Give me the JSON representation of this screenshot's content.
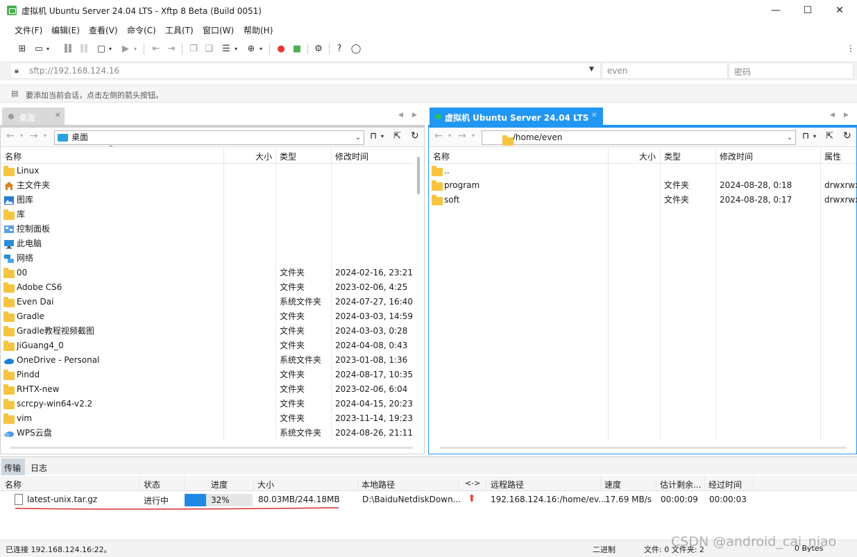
{
  "window": {
    "title": "虚拟机 Ubuntu Server 24.04 LTS - Xftp 8 Beta (Build 0051)",
    "minimize": "—",
    "maximize": "☐",
    "close": "✕"
  },
  "menu": [
    "文件(F)",
    "编辑(E)",
    "查看(V)",
    "命令(C)",
    "工具(T)",
    "窗口(W)",
    "帮助(H)"
  ],
  "address": {
    "url_placeholder": "sftp://192.168.124.16",
    "user_placeholder": "even",
    "password_placeholder": "密码"
  },
  "hint": "要添加当前会话，点击左侧的箭头按钮。",
  "left": {
    "tab": "桌面",
    "path": "桌面",
    "columns": [
      "名称",
      "大小",
      "类型",
      "修改时间"
    ],
    "rows": [
      {
        "name": "Linux",
        "icon": "folder",
        "type": "",
        "date": ""
      },
      {
        "name": "主文件夹",
        "icon": "home",
        "type": "",
        "date": ""
      },
      {
        "name": "图库",
        "icon": "gallery",
        "type": "",
        "date": ""
      },
      {
        "name": "库",
        "icon": "folder",
        "type": "",
        "date": ""
      },
      {
        "name": "控制面板",
        "icon": "control",
        "type": "",
        "date": ""
      },
      {
        "name": "此电脑",
        "icon": "pc",
        "type": "",
        "date": ""
      },
      {
        "name": "网络",
        "icon": "network",
        "type": "",
        "date": ""
      },
      {
        "name": "00",
        "icon": "folder",
        "type": "文件夹",
        "date": "2024-02-16, 23:21"
      },
      {
        "name": "Adobe CS6",
        "icon": "folder",
        "type": "文件夹",
        "date": "2023-02-06, 4:25"
      },
      {
        "name": "Even Dai",
        "icon": "folder",
        "type": "系统文件夹",
        "date": "2024-07-27, 16:40"
      },
      {
        "name": "Gradle",
        "icon": "folder",
        "type": "文件夹",
        "date": "2024-03-03, 14:59"
      },
      {
        "name": "Gradle教程视频截图",
        "icon": "folder",
        "type": "文件夹",
        "date": "2024-03-03, 0:28"
      },
      {
        "name": "JiGuang4_0",
        "icon": "folder",
        "type": "文件夹",
        "date": "2024-04-08, 0:43"
      },
      {
        "name": "OneDrive - Personal",
        "icon": "cloud",
        "type": "系统文件夹",
        "date": "2023-01-08, 1:36"
      },
      {
        "name": "Pindd",
        "icon": "folder",
        "type": "文件夹",
        "date": "2024-08-17, 10:35"
      },
      {
        "name": "RHTX-new",
        "icon": "folder",
        "type": "文件夹",
        "date": "2023-02-06, 6:04"
      },
      {
        "name": "scrcpy-win64-v2.2",
        "icon": "folder",
        "type": "文件夹",
        "date": "2024-04-15, 20:23"
      },
      {
        "name": "vim",
        "icon": "folder",
        "type": "文件夹",
        "date": "2023-11-14, 19:23"
      },
      {
        "name": "WPS云盘",
        "icon": "wpscloud",
        "type": "系统文件夹",
        "date": "2024-08-26, 21:11"
      }
    ]
  },
  "right": {
    "tab": "虚拟机 Ubuntu Server 24.04 LTS",
    "path": "/home/even",
    "columns": [
      "名称",
      "大小",
      "类型",
      "修改时间",
      "属性"
    ],
    "rows": [
      {
        "name": "..",
        "type": "",
        "date": "",
        "attr": ""
      },
      {
        "name": "program",
        "type": "文件夹",
        "date": "2024-08-28, 0:18",
        "attr": "drwxrwx"
      },
      {
        "name": "soft",
        "type": "文件夹",
        "date": "2024-08-28, 0:17",
        "attr": "drwxrwx"
      }
    ]
  },
  "bottom_tabs": [
    "传输",
    "日志"
  ],
  "transfer": {
    "columns": [
      "名称",
      "状态",
      "进度",
      "大小",
      "本地路径",
      "<->",
      "远程路径",
      "速度",
      "估计剩余...",
      "经过时间"
    ],
    "rows": [
      {
        "name": "latest-unix.tar.gz",
        "status": "进行中",
        "progress_label": "32%",
        "progress": 0.32,
        "size": "80.03MB/244.18MB",
        "local": "D:\\BaiduNetdiskDown...",
        "remote": "192.168.124.16:/home/ev...",
        "speed": "17.69 MB/s",
        "remaining": "00:00:09",
        "elapsed": "00:00:03"
      }
    ]
  },
  "status": {
    "connection": "已连接 192.168.124.16:22。",
    "mode": "二进制",
    "files": "文件: 0 文件夹: 2",
    "bytes": "0 Bytes"
  },
  "watermark": "CSDN @android_cai_niao",
  "colors": {
    "accent": "#1e88e5",
    "active_tab": "#2196f3",
    "connected_dot": "#22c55e",
    "upload_arrow": "#e53935",
    "underline": "#d32f2f"
  }
}
